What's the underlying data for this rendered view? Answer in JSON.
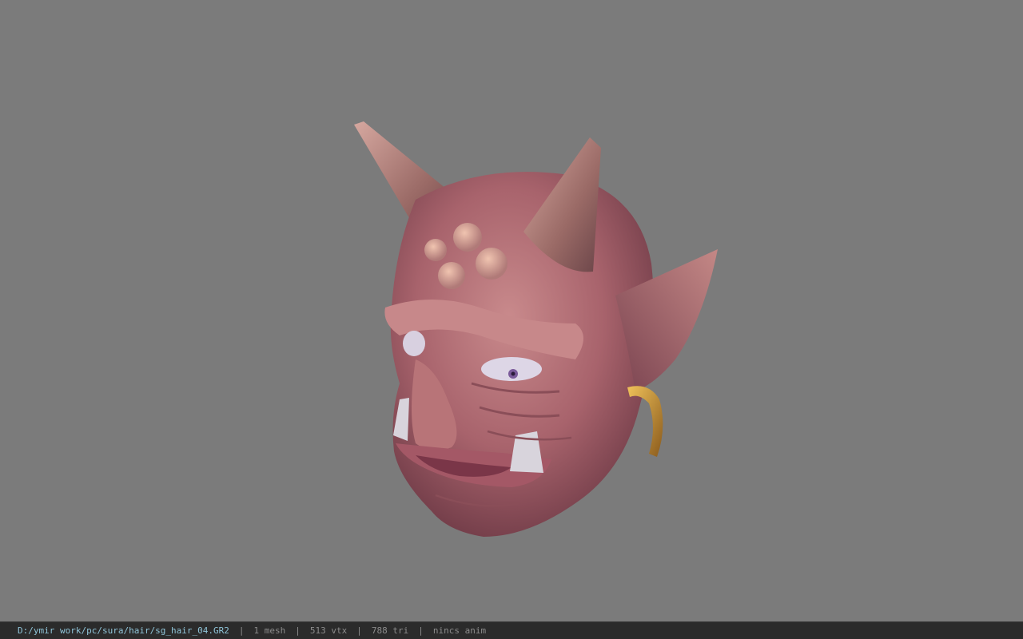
{
  "viewport": {
    "background_color": "#7b7b7b",
    "model_icon": "oni-demon-head-model"
  },
  "statusbar": {
    "file_path": "D:/ymir work/pc/sura/hair/sg_hair_04.GR2",
    "mesh_count": "1 mesh",
    "vertex_count": "513 vtx",
    "triangle_count": "788 tri",
    "anim_status": "nincs anim",
    "separator": "|",
    "path_color": "#8fc4d8",
    "text_color": "#8c8c8c",
    "background_color": "#2b2b2b"
  }
}
